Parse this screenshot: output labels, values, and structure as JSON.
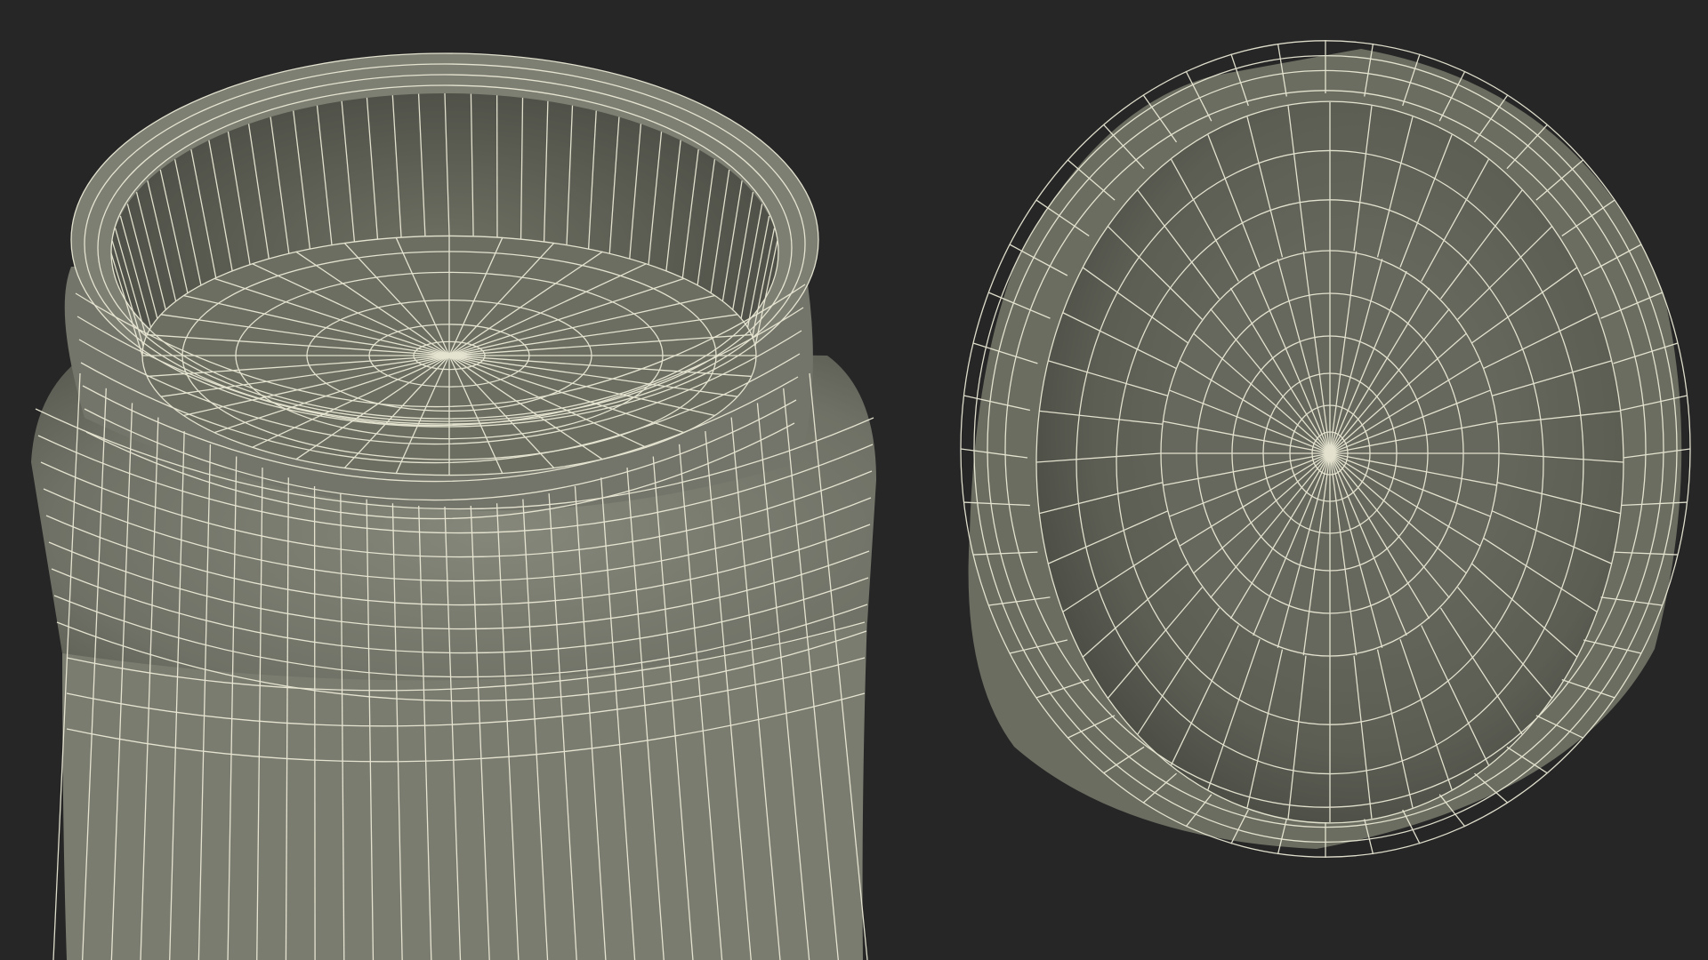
{
  "scene": {
    "background_color": "#262626",
    "surface_color": "#7a7b6f",
    "wire_color": "#f2f0dc",
    "objects": [
      {
        "name": "jar-body",
        "kind": "wireframe-jar"
      },
      {
        "name": "jar-lid",
        "kind": "wireframe-lid"
      }
    ]
  }
}
